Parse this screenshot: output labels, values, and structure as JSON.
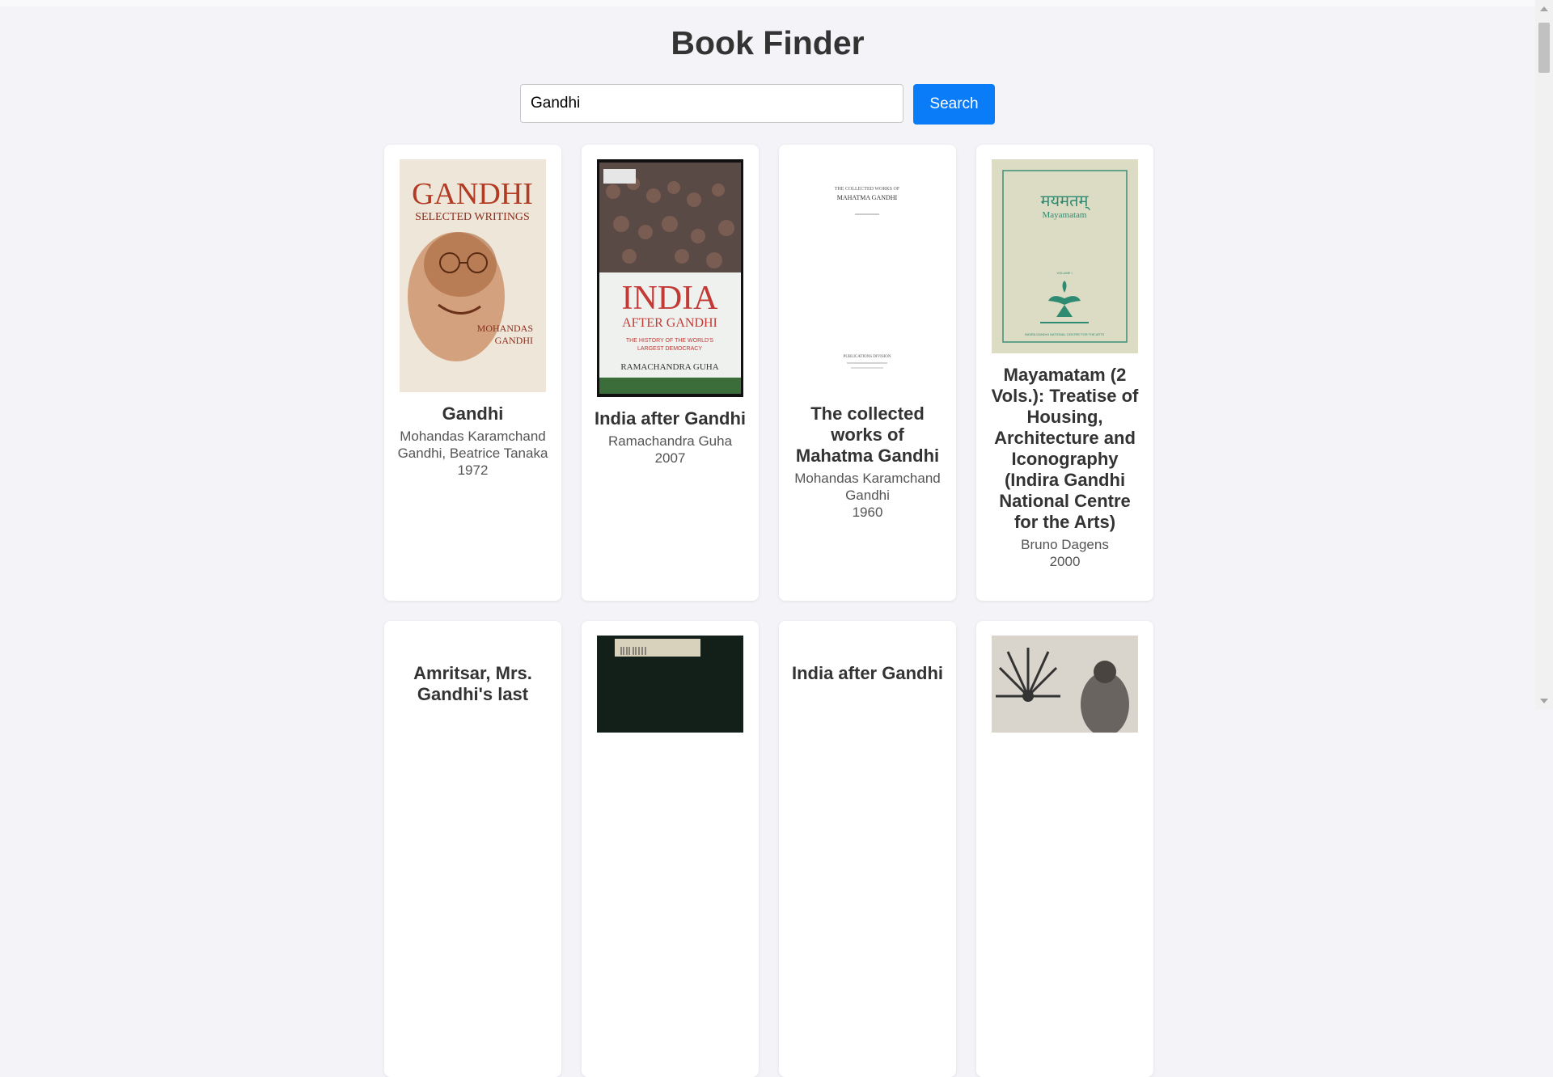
{
  "app": {
    "title": "Book Finder"
  },
  "search": {
    "value": "Gandhi",
    "button_label": "Search"
  },
  "books": [
    {
      "title": "Gandhi",
      "author": "Mohandas Karamchand Gandhi, Beatrice Tanaka",
      "year": "1972",
      "cover": {
        "line1": "GANDHI",
        "line2": "SELECTED WRITINGS",
        "line3": "MOHANDAS",
        "line4": "GANDHI"
      }
    },
    {
      "title": "India after Gandhi",
      "author": "Ramachandra Guha",
      "year": "2007",
      "cover": {
        "line1": "INDIA",
        "line2": "AFTER GANDHI",
        "line3": "THE HISTORY OF THE WORLD'S",
        "line4": "LARGEST DEMOCRACY",
        "line5": "RAMACHANDRA GUHA"
      }
    },
    {
      "title": "The collected works of Mahatma Gandhi",
      "author": "Mohandas Karamchand Gandhi",
      "year": "1960",
      "cover": {
        "line1": "THE COLLECTED WORKS OF",
        "line2": "MAHATMA GANDHI",
        "line3": "PUBLICATIONS DIVISION"
      }
    },
    {
      "title": "Mayamatam (2 Vols.): Treatise of Housing, Architecture and Iconography (Indira Gandhi National Centre for the Arts)",
      "author": "Bruno Dagens",
      "year": "2000",
      "cover": {
        "line1": "मयमतम्",
        "line2": "Mayamatam",
        "line3": "VOLUME I",
        "line4": "INDIRA GANDHI NATIONAL CENTRE FOR THE ARTS"
      }
    },
    {
      "title": "Amritsar, Mrs. Gandhi's last"
    },
    {
      "title": ""
    },
    {
      "title": "India after Gandhi"
    },
    {
      "title": ""
    }
  ]
}
